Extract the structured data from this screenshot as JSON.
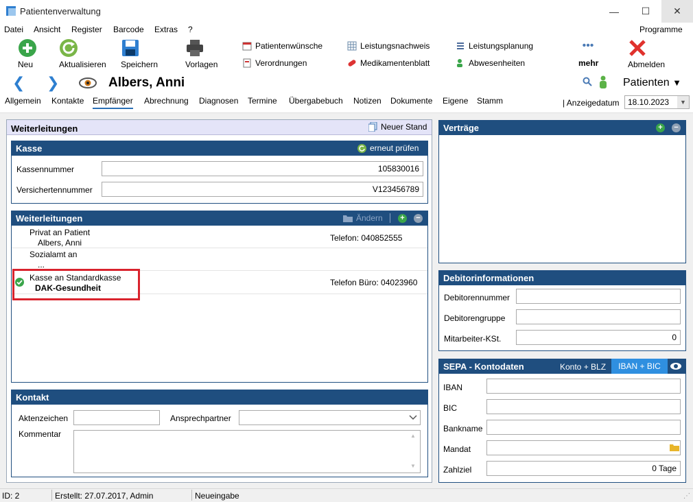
{
  "window": {
    "title": "Patientenverwaltung",
    "min": "—",
    "max": "☐",
    "close": "✕"
  },
  "menu": {
    "items": [
      "Datei",
      "Ansicht",
      "Register",
      "Barcode",
      "Extras",
      "?"
    ],
    "programme": "Programme"
  },
  "toolbar": {
    "neu": "Neu",
    "aktualisieren": "Aktualisieren",
    "speichern": "Speichern",
    "vorlagen": "Vorlagen",
    "patientenwuensche": "Patientenwünsche",
    "verordnungen": "Verordnungen",
    "leistungsnachweis": "Leistungsnachweis",
    "medikamentenblatt": "Medikamentenblatt",
    "leistungsplanung": "Leistungsplanung",
    "abwesenheiten": "Abwesenheiten",
    "mehr": "mehr",
    "abmelden": "Abmelden"
  },
  "patient": {
    "name": "Albers, Anni",
    "menu_label": "Patienten"
  },
  "tabs": [
    "Allgemein",
    "Kontakte",
    "Empfänger",
    "Abrechnung",
    "Diagnosen",
    "Termine",
    "Übergabebuch",
    "Notizen",
    "Dokumente",
    "Eigene",
    "Stamm"
  ],
  "anzeigedatum": {
    "label": "Anzeigedatum",
    "value": "18.10.2023"
  },
  "weiterleitungen_panel": {
    "title": "Weiterleitungen",
    "neuer_stand": "Neuer Stand",
    "kasse": {
      "title": "Kasse",
      "erneut_pruefen": "erneut prüfen",
      "kassennummer_label": "Kassennummer",
      "kassennummer": "105830016",
      "versichertennummer_label": "Versichertennummer",
      "versichertennummer": "V123456789"
    },
    "liste": {
      "title": "Weiterleitungen",
      "aendern": "Ändern",
      "entries": [
        {
          "line1": "Privat an Patient",
          "line2": "Albers, Anni",
          "right": "Telefon: 040852555"
        },
        {
          "line1": "Sozialamt an",
          "line2": "...",
          "right": ""
        },
        {
          "line1": "Kasse an Standardkasse",
          "line2": "DAK-Gesundheit",
          "right": "Telefon Büro: 04023960"
        }
      ]
    },
    "kontakt": {
      "title": "Kontakt",
      "aktenzeichen_label": "Aktenzeichen",
      "aktenzeichen": "",
      "ansprechpartner_label": "Ansprechpartner",
      "ansprechpartner": "",
      "kommentar_label": "Kommentar",
      "kommentar": ""
    }
  },
  "vertraege": {
    "title": "Verträge"
  },
  "debitor": {
    "title": "Debitorinformationen",
    "debitorennummer_label": "Debitorennummer",
    "debitorennummer": "",
    "debitorengruppe_label": "Debitorengruppe",
    "debitorengruppe": "",
    "mitarbeiter_label": "Mitarbeiter-KSt.",
    "mitarbeiter": "0"
  },
  "sepa": {
    "title": "SEPA - Kontodaten",
    "konto_blz": "Konto + BLZ",
    "iban_bic": "IBAN + BIC",
    "iban_label": "IBAN",
    "iban": "",
    "bic_label": "BIC",
    "bic": "",
    "bankname_label": "Bankname",
    "bankname": "",
    "mandat_label": "Mandat",
    "mandat": "",
    "zahlziel_label": "Zahlziel",
    "zahlziel": "0 Tage"
  },
  "status": {
    "id": "ID: 2",
    "erstellt": "Erstellt: 27.07.2017, Admin",
    "mode": "Neueingabe"
  },
  "colors": {
    "accent": "#1f4e7f",
    "highlight": "#d9232d",
    "green": "#3aa54a"
  }
}
